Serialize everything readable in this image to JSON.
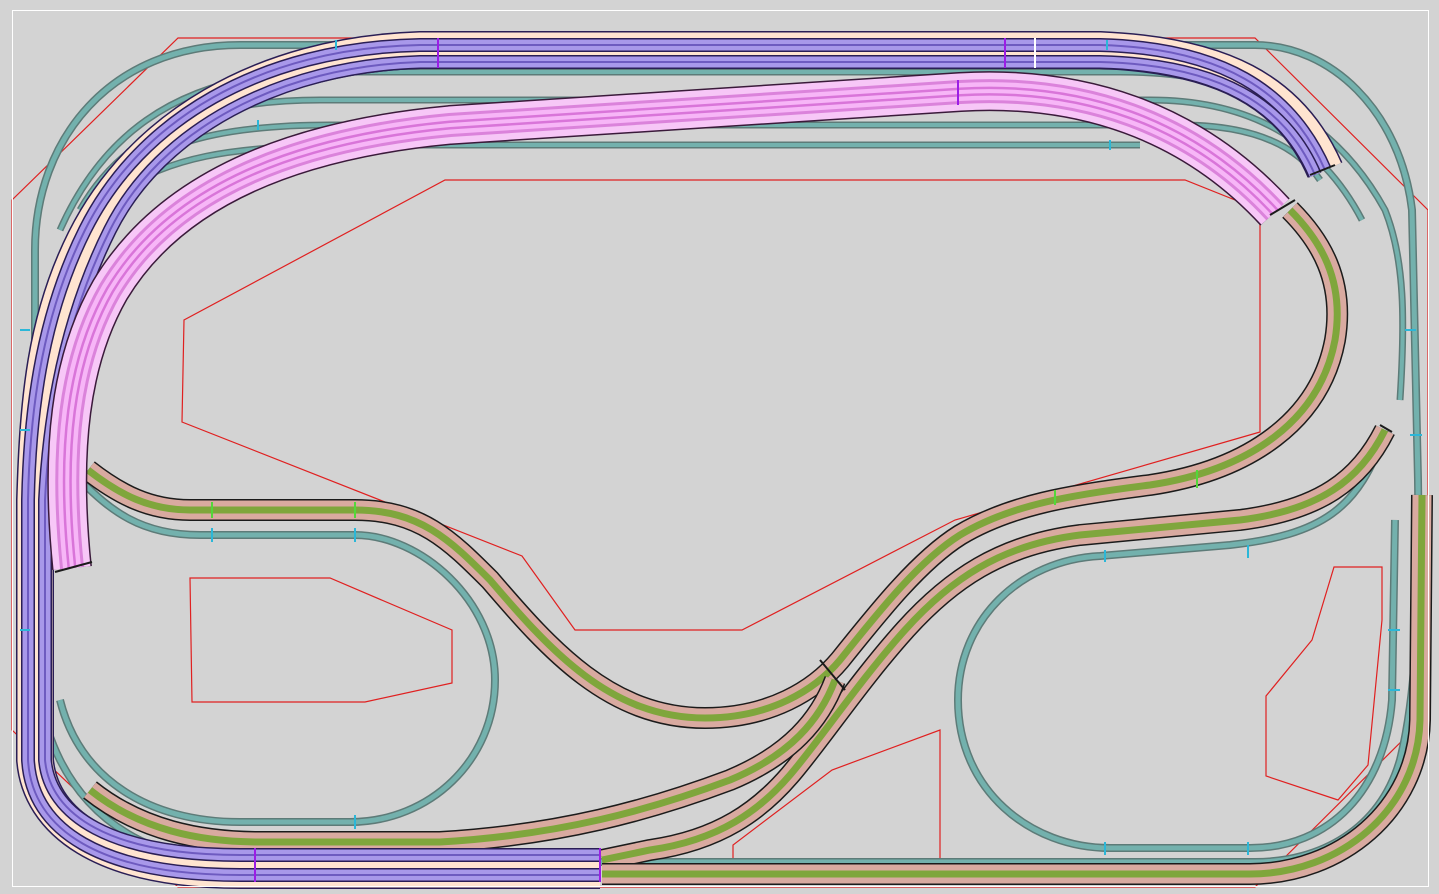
{
  "diagram": {
    "kind": "model railway track plan (top view)",
    "colors": {
      "background": "#d3d3d3",
      "outline": "#e02020",
      "upper_level": "#ffe4d0",
      "lavender_bed": "#a898ea",
      "pink_bed": "#f4a8f4",
      "green_bed": "#d9aaa0",
      "green_track": "#7fa63c",
      "teal_track": "#73b1ad",
      "tie_mark_green": "#53d83a",
      "tie_mark_teal": "#2bb7d8",
      "tie_mark_purple": "#9c1de6"
    },
    "layers": [
      "board-outline",
      "scenery-outlines",
      "teal-tracks",
      "green-tracks",
      "upper-level-tracks"
    ]
  }
}
